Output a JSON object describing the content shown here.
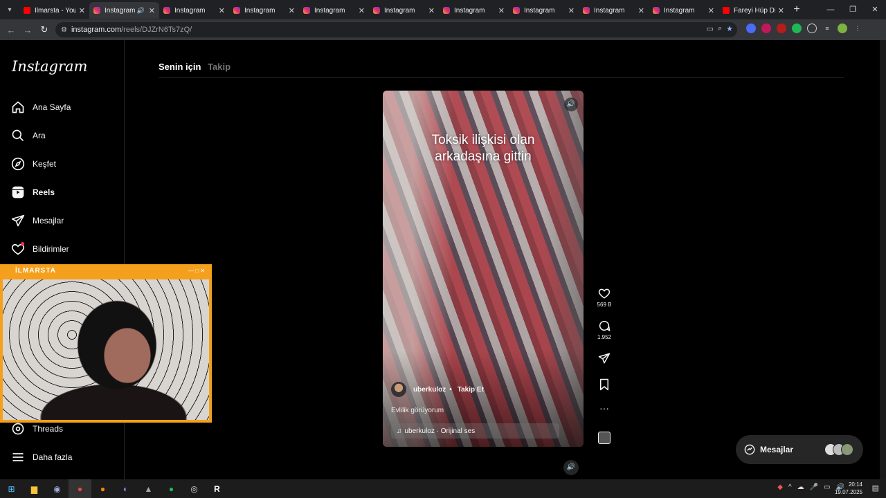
{
  "browser": {
    "tabs": [
      {
        "title": "İlmarsta - YouT",
        "favicon": "youtube-icon",
        "active": false
      },
      {
        "title": "Instagram",
        "favicon": "instagram-icon",
        "active": true,
        "audio": true
      },
      {
        "title": "Instagram",
        "favicon": "instagram-icon",
        "active": false
      },
      {
        "title": "Instagram",
        "favicon": "instagram-icon",
        "active": false
      },
      {
        "title": "Instagram",
        "favicon": "instagram-icon",
        "active": false
      },
      {
        "title": "Instagram",
        "favicon": "instagram-icon",
        "active": false
      },
      {
        "title": "Instagram",
        "favicon": "instagram-icon",
        "active": false
      },
      {
        "title": "Instagram",
        "favicon": "instagram-icon",
        "active": false
      },
      {
        "title": "Instagram",
        "favicon": "instagram-icon",
        "active": false
      },
      {
        "title": "Instagram",
        "favicon": "instagram-icon",
        "active": false
      },
      {
        "title": "Fareyi Hüp Diy",
        "favicon": "youtube-icon",
        "active": false
      }
    ],
    "url_host": "instagram.com",
    "url_path": "/reels/DJZrN6Ts7zQ/"
  },
  "sidebar": {
    "logo": "Instagram",
    "items": [
      {
        "label": "Ana Sayfa",
        "icon": "home-icon"
      },
      {
        "label": "Ara",
        "icon": "search-icon"
      },
      {
        "label": "Keşfet",
        "icon": "compass-icon"
      },
      {
        "label": "Reels",
        "icon": "reels-icon",
        "active": true
      },
      {
        "label": "Mesajlar",
        "icon": "send-icon"
      },
      {
        "label": "Bildirimler",
        "icon": "heart-icon"
      },
      {
        "label": "Threads",
        "icon": "threads-icon"
      },
      {
        "label": "Daha fazla",
        "icon": "menu-icon"
      }
    ]
  },
  "feed": {
    "tab_for_you": "Senin için",
    "tab_following": "Takip"
  },
  "reel": {
    "overlay_text_line1": "Toksik ilişkisi olan",
    "overlay_text_line2": "arkadaşına gittin",
    "username": "uberkuloz",
    "separator": "•",
    "follow_label": "Takip Et",
    "description": "Evlilik görüyorum",
    "audio_label": "uberkuloz · Orijinal ses",
    "likes": "569 B",
    "comments": "1.952"
  },
  "messages_pill": {
    "label": "Mesajlar"
  },
  "webcam": {
    "title": "İLMARSTA"
  },
  "taskbar": {
    "time": "20:14",
    "date": "19.07.2025"
  },
  "colors": {
    "webcam_border": "#f4a01c",
    "background": "#000000",
    "browser_chrome": "#202124"
  }
}
